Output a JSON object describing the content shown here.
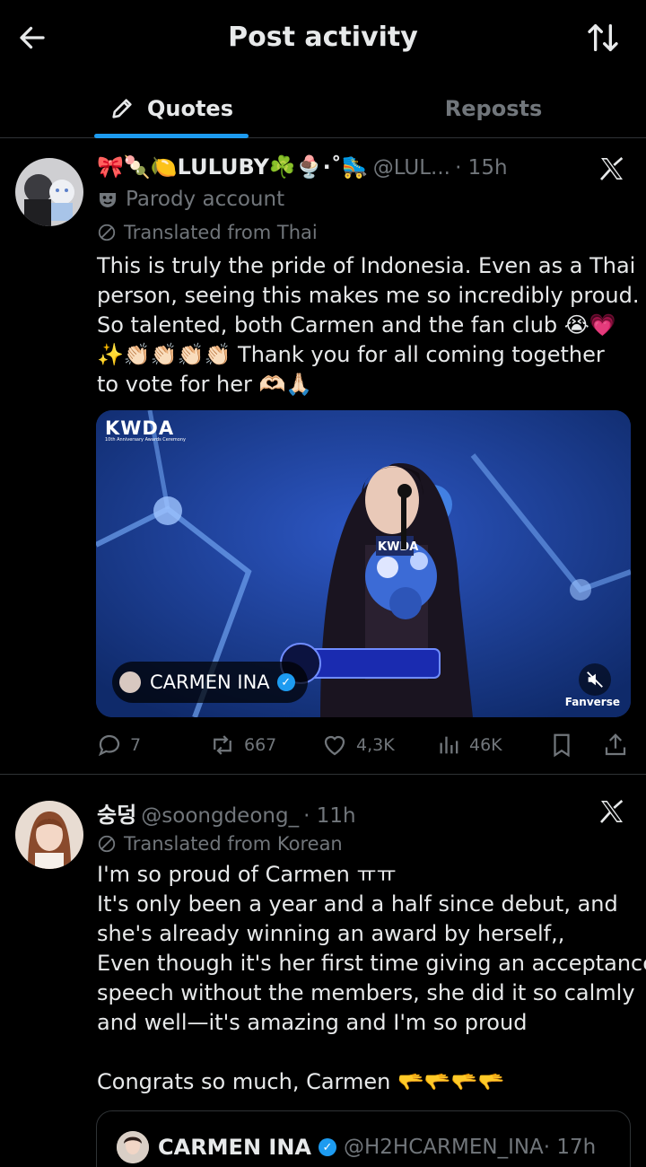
{
  "header": {
    "title": "Post activity"
  },
  "tabs": [
    {
      "label": "Quotes",
      "active": true
    },
    {
      "label": "Reposts",
      "active": false
    }
  ],
  "posts": [
    {
      "name": "🎀🍡🍋LULUBY☘️🍨·˚🛼",
      "handle": "@LUL...",
      "time": "· 15h",
      "badge": "Parody account",
      "translated": "Translated from Thai",
      "lines": [
        "This is truly the pride of Indonesia. Even as a Thai",
        "person, seeing this makes me so incredibly proud.",
        "So talented, both Carmen and the fan club 😭💗",
        "✨👏🏻👏🏻👏🏻👏🏻 Thank you for all coming together",
        "to vote for her 🫶🏻🙏🏻"
      ],
      "media": {
        "logo": "KWDA",
        "logo_sub": "10th Anniversary Awards Ceremony",
        "account": "CARMEN INA",
        "watermark": "Fanverse"
      },
      "stats": {
        "replies": "7",
        "reposts": "667",
        "likes": "4,3K",
        "views": "46K"
      }
    },
    {
      "name": "숭덩",
      "handle": "@soongdeong_",
      "time": "· 11h",
      "translated": "Translated from Korean",
      "lines": [
        "I'm so proud of Carmen ㅠㅠ",
        "It's only been a year and a half since debut, and",
        "she's already winning an award by herself,,",
        "Even though it's her first time giving an acceptance",
        "speech without the members, she did it so calmly",
        "and well—it's amazing and I'm so proud",
        "",
        "Congrats so much, Carmen 🫳🫳🫳🫳"
      ],
      "quoted": {
        "name": "CARMEN INA",
        "handle": "@H2HCARMEN_INA",
        "time": "· 17h"
      }
    }
  ],
  "icons": {
    "back": "arrow-left-icon",
    "sort": "sort-arrows-icon",
    "platform": "x-logo-icon"
  },
  "colors": {
    "background": "#000000",
    "accent": "#1d9bf0",
    "text_primary": "#e7e9ea",
    "text_secondary": "#71767b",
    "divider": "#2f3336"
  }
}
